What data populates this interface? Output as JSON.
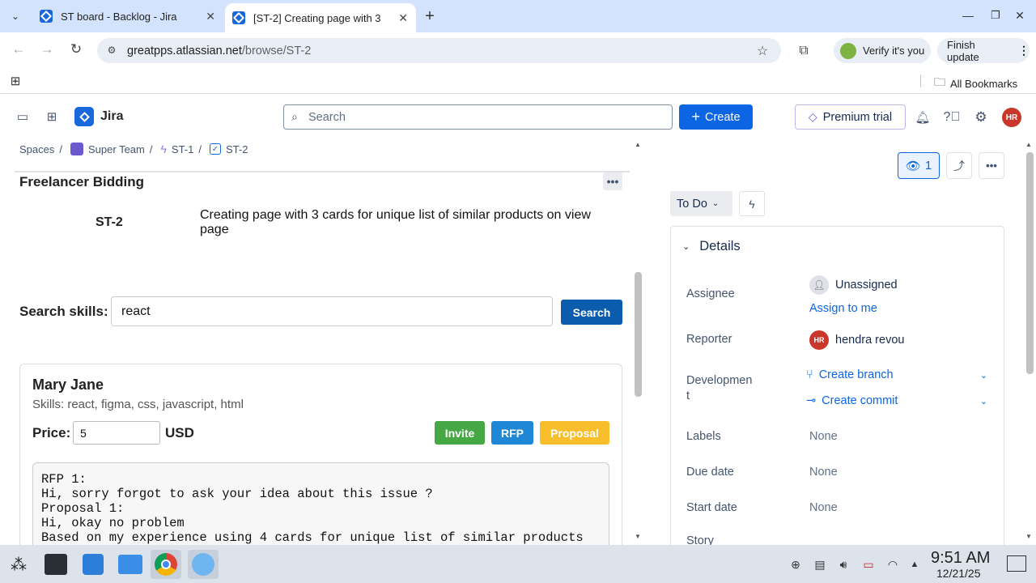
{
  "browser": {
    "tabs": [
      {
        "title": "ST board - Backlog - Jira"
      },
      {
        "title": "[ST-2] Creating page with 3"
      }
    ],
    "url_host": "greatpps.atlassian.net",
    "url_path": "/browse/ST-2",
    "verify_label": "Verify it's you",
    "update_label": "Finish update",
    "bookmarks_label": "All Bookmarks"
  },
  "jira": {
    "app_name": "Jira",
    "search_placeholder": "Search",
    "create_label": "Create",
    "premium_label": "Premium trial",
    "avatar_initials": "HR"
  },
  "breadcrumb": {
    "spaces": "Spaces",
    "team": "Super Team",
    "epic": "ST-1",
    "issue": "ST-2",
    "sep": "/"
  },
  "app": {
    "title": "Freelancer Bidding",
    "issue_key": "ST-2",
    "issue_summary": "Creating page with 3 cards for unique list of similar products on view page",
    "search_label": "Search skills:",
    "search_value": "react",
    "search_button": "Search",
    "freelancer": {
      "name": "Mary Jane",
      "skills": "Skills: react, figma, css, javascript, html",
      "price_label": "Price:",
      "price_value": "5",
      "currency": "USD",
      "invite": "Invite",
      "rfp": "RFP",
      "proposal": "Proposal",
      "messages": "RFP 1:\nHi, sorry forgot to ask your idea about this issue ?\nProposal 1:\nHi, okay no problem\nBased on my experience using 4 cards for unique list of similar products"
    }
  },
  "issue_panel": {
    "watch_count": "1",
    "status": "To Do",
    "details_title": "Details",
    "assignee_label": "Assignee",
    "assignee_value": "Unassigned",
    "assign_link": "Assign to me",
    "reporter_label": "Reporter",
    "reporter_initials": "HR",
    "reporter_name": "hendra revou",
    "development_label_1": "Developmen",
    "development_label_2": "t",
    "create_branch": "Create branch",
    "create_commit": "Create commit",
    "labels_label": "Labels",
    "labels_value": "None",
    "due_label": "Due date",
    "due_value": "None",
    "start_label": "Start date",
    "start_value": "None",
    "story_label": "Story"
  },
  "taskbar": {
    "time": "9:51 AM",
    "date": "12/21/25"
  },
  "colors": {
    "invite": "#46a844",
    "rfp": "#1e88d6",
    "proposal": "#f8be2b",
    "jira_blue": "#0c66e4",
    "search_btn": "#0b5cad"
  }
}
